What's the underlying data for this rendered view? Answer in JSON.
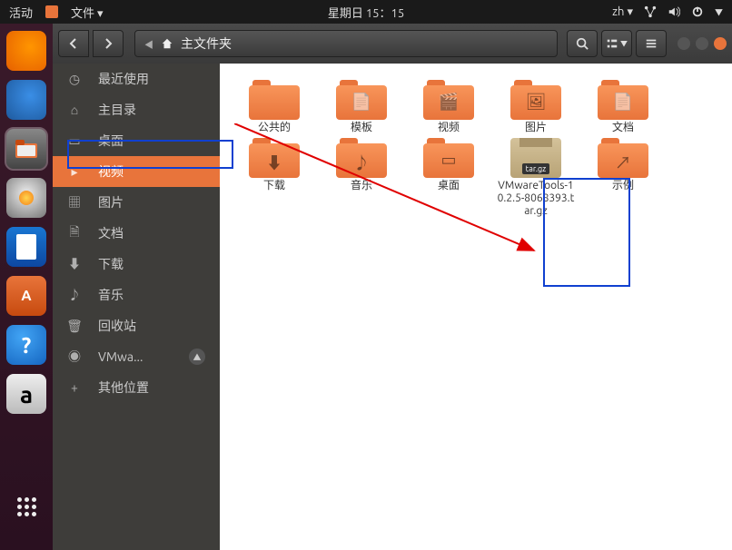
{
  "topbar": {
    "activities": "活动",
    "app_menu": "文件",
    "datetime": "星期日 15：15",
    "ime": "zh"
  },
  "path": {
    "location": "主文件夹"
  },
  "sidebar": [
    {
      "id": "recent",
      "label": "最近使用",
      "icon": "clock"
    },
    {
      "id": "home",
      "label": "主目录",
      "icon": "home",
      "highlighted": true
    },
    {
      "id": "desktop",
      "label": "桌面",
      "icon": "folder"
    },
    {
      "id": "videos",
      "label": "视频",
      "icon": "video",
      "active": true
    },
    {
      "id": "pictures",
      "label": "图片",
      "icon": "image"
    },
    {
      "id": "documents",
      "label": "文档",
      "icon": "doc"
    },
    {
      "id": "downloads",
      "label": "下载",
      "icon": "down"
    },
    {
      "id": "music",
      "label": "音乐",
      "icon": "music"
    },
    {
      "id": "trash",
      "label": "回收站",
      "icon": "trash"
    },
    {
      "id": "vmware-media",
      "label": "VMwa...",
      "icon": "disc",
      "eject": true
    },
    {
      "id": "other",
      "label": "其他位置",
      "icon": "plus"
    }
  ],
  "items": {
    "row1": [
      {
        "name": "public",
        "label": "公共的",
        "deco": ""
      },
      {
        "name": "templates",
        "label": "模板",
        "deco": "📄"
      },
      {
        "name": "videos",
        "label": "视频",
        "deco": "🎬"
      },
      {
        "name": "pictures",
        "label": "图片",
        "deco": "🖼"
      },
      {
        "name": "documents",
        "label": "文档",
        "deco": "📄"
      }
    ],
    "row2": [
      {
        "name": "downloads",
        "label": "下载",
        "deco": "⬇"
      },
      {
        "name": "music",
        "label": "音乐",
        "deco": "♪"
      },
      {
        "name": "desktop",
        "label": "桌面",
        "deco": "▭"
      },
      {
        "name": "vmwaretools-archive",
        "label": "VMwareTools-10.2.5-8068393.tar.gz",
        "type": "tar",
        "tag": "tar.gz"
      },
      {
        "name": "examples",
        "label": "示例",
        "deco": "↗",
        "link": true
      }
    ]
  },
  "launcher": [
    {
      "name": "firefox"
    },
    {
      "name": "thunderbird"
    },
    {
      "name": "files",
      "active": true
    },
    {
      "name": "rhythmbox"
    },
    {
      "name": "libreoffice-writer"
    },
    {
      "name": "ubuntu-software"
    },
    {
      "name": "help"
    },
    {
      "name": "amazon"
    },
    {
      "name": "show-apps"
    }
  ]
}
